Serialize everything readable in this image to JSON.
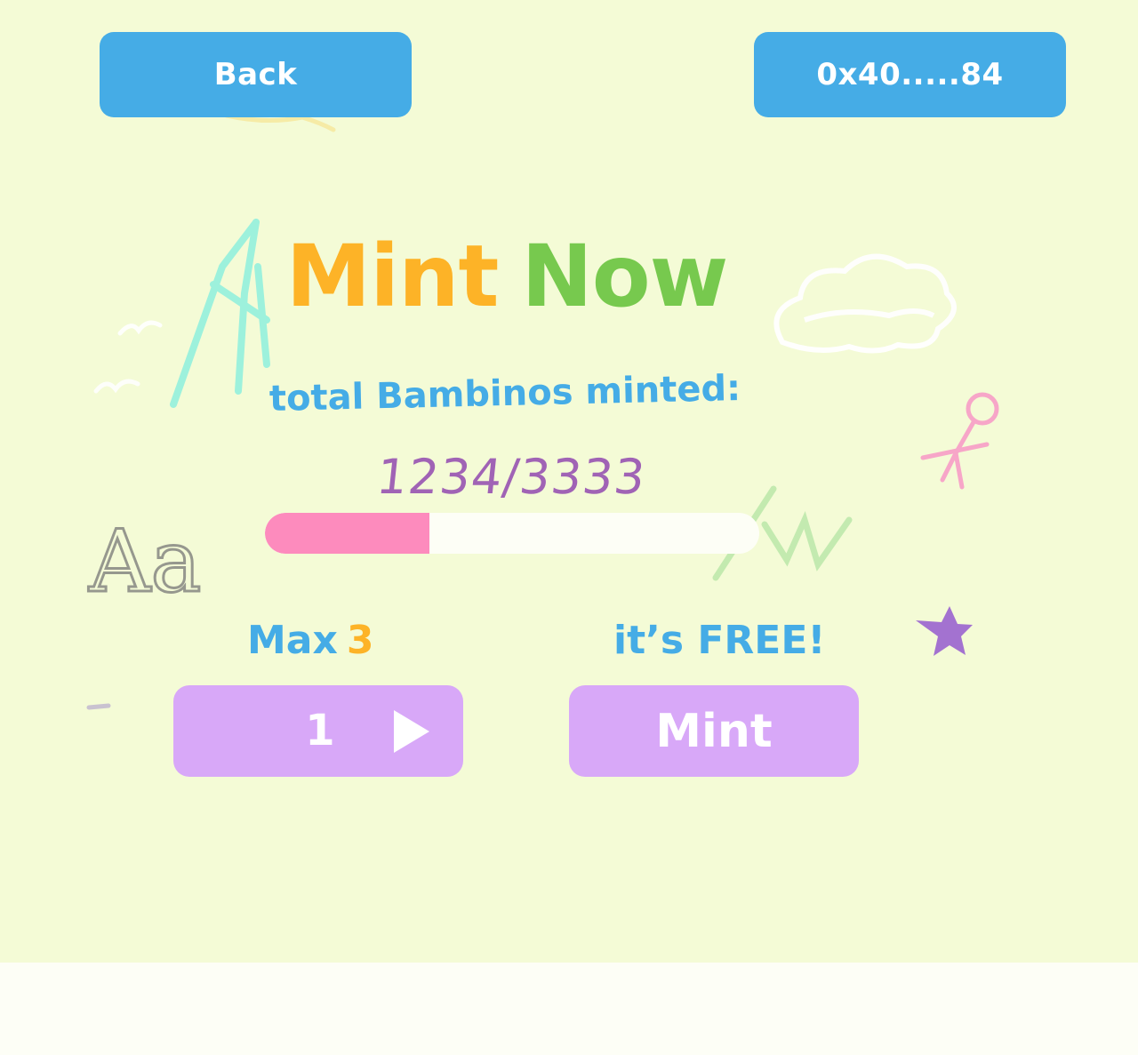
{
  "header": {
    "back_label": "Back",
    "wallet_label": "0x40.....84"
  },
  "title": {
    "word1": "Mint",
    "word2": "Now"
  },
  "subtitle": "total Bambinos minted:",
  "counter": {
    "text": "1234/3333",
    "minted": 1234,
    "total": 3333,
    "progress_fraction": 0.333
  },
  "max": {
    "label": "Max",
    "value": "3"
  },
  "price_note": "it’s FREE!",
  "quantity": {
    "value": "1",
    "increment_icon": "play-triangle-icon"
  },
  "mint_label": "Mint",
  "colors": {
    "background": "#f4fbd6",
    "button_blue": "#45ace6",
    "button_purple": "#d8a8f8",
    "title_orange": "#fdb327",
    "title_green": "#77c94e",
    "counter_purple": "#a063b5",
    "progress_pink": "#fd8bbd"
  }
}
